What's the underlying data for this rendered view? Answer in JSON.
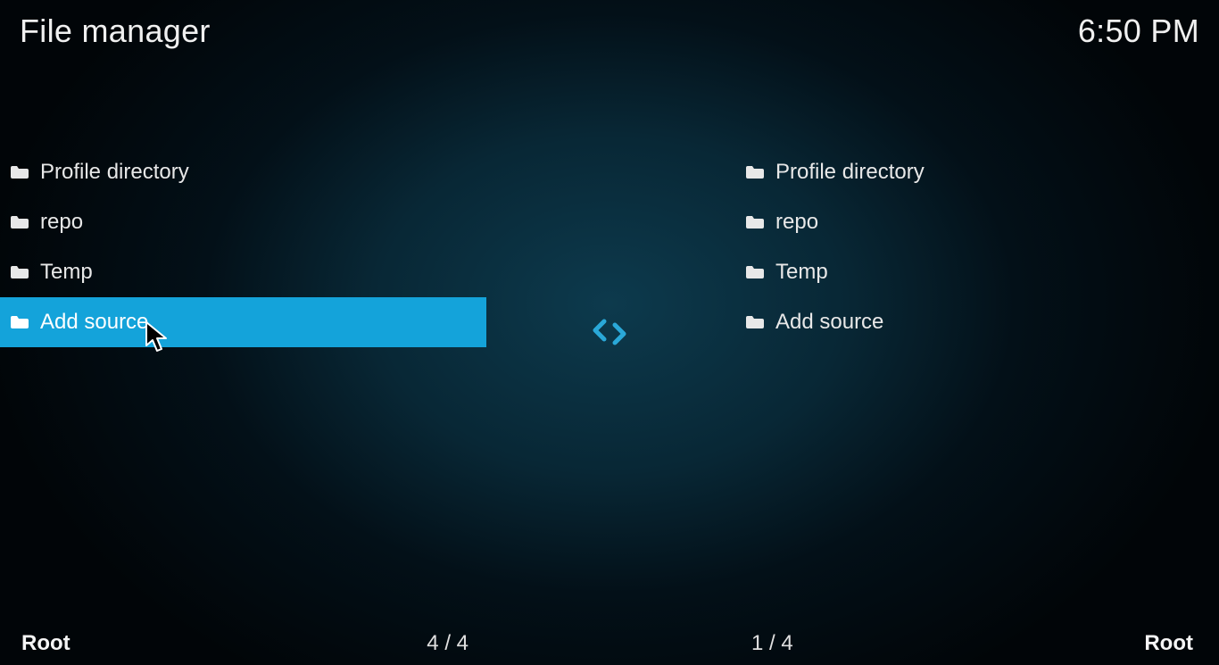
{
  "header": {
    "title": "File manager",
    "time": "6:50 PM"
  },
  "left": {
    "items": [
      {
        "label": "Profile directory",
        "selected": false
      },
      {
        "label": "repo",
        "selected": false
      },
      {
        "label": "Temp",
        "selected": false
      },
      {
        "label": "Add source",
        "selected": true
      }
    ],
    "location": "Root",
    "counter": "4 / 4"
  },
  "right": {
    "items": [
      {
        "label": "Profile directory",
        "selected": false
      },
      {
        "label": "repo",
        "selected": false
      },
      {
        "label": "Temp",
        "selected": false
      },
      {
        "label": "Add source",
        "selected": false
      }
    ],
    "location": "Root",
    "counter": "1 / 4"
  },
  "colors": {
    "accent": "#14a3da",
    "swap_arrow": "#2aa8d8"
  }
}
